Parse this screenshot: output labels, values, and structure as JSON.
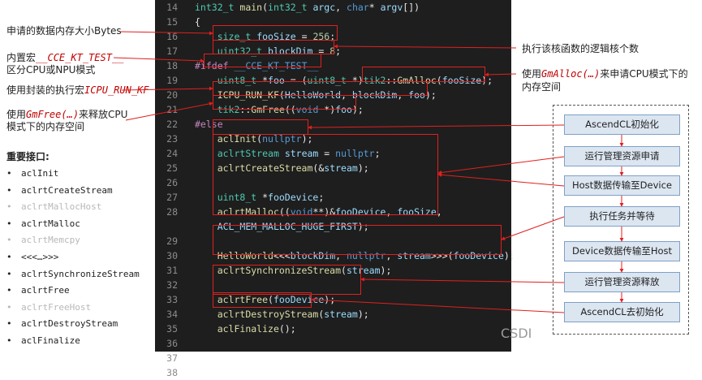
{
  "left_notes": {
    "n1": "申请的数据内存大小Bytes",
    "n2_prefix": "内置宏",
    "n2_hl": "__CCE_KT_TEST__",
    "n2_line2": "区分CPU或NPU模式",
    "n3_prefix": "使用封装的执行宏",
    "n3_hl": "ICPU_RUN_KF",
    "n4_prefix": "使用",
    "n4_hl": "GmFree(…)",
    "n4_suffix": "来释放CPU",
    "n4_line2": "模式下的内存空间"
  },
  "apis": {
    "heading": "重要接口:",
    "items": [
      {
        "name": "aclInit",
        "gray": false
      },
      {
        "name": "aclrtCreateStream",
        "gray": false
      },
      {
        "name": "aclrtMallocHost",
        "gray": true
      },
      {
        "name": "aclrtMalloc",
        "gray": false
      },
      {
        "name": "aclrtMemcpy",
        "gray": true
      },
      {
        "name": "<<<…>>>",
        "gray": false
      },
      {
        "name": "aclrtSynchronizeStream",
        "gray": false
      },
      {
        "name": "aclrtFree",
        "gray": false
      },
      {
        "name": "aclrtFreeHost",
        "gray": true
      },
      {
        "name": "aclrtDestroyStream",
        "gray": false
      },
      {
        "name": "aclFinalize",
        "gray": false
      }
    ]
  },
  "code": {
    "line_numbers": [
      "14",
      "15",
      "16",
      "17",
      "18",
      "19",
      "20",
      "21",
      "22",
      "23",
      "24",
      "25",
      "26",
      "27",
      "28",
      "29",
      "30",
      "31",
      "32",
      "33",
      "34",
      "35",
      "36",
      "37",
      "38"
    ]
  },
  "right_notes": {
    "r1": "执行该核函数的逻辑核个数",
    "r2_prefix": "使用",
    "r2_hl": "GmAlloc(…)",
    "r2_suffix": "来申请CPU模式下的",
    "r2_line2": "内存空间"
  },
  "flow": {
    "steps": [
      "AscendCL初始化",
      "运行管理资源申请",
      "Host数据传输至Device",
      "执行任务并等待",
      "Device数据传输至Host",
      "运行管理资源释放",
      "AscendCL去初始化"
    ]
  },
  "watermark": "CSDI",
  "colors": {
    "accent_red": "#e0201e",
    "code_bg": "#1e1e1e",
    "step_bg": "#dce6f1"
  }
}
